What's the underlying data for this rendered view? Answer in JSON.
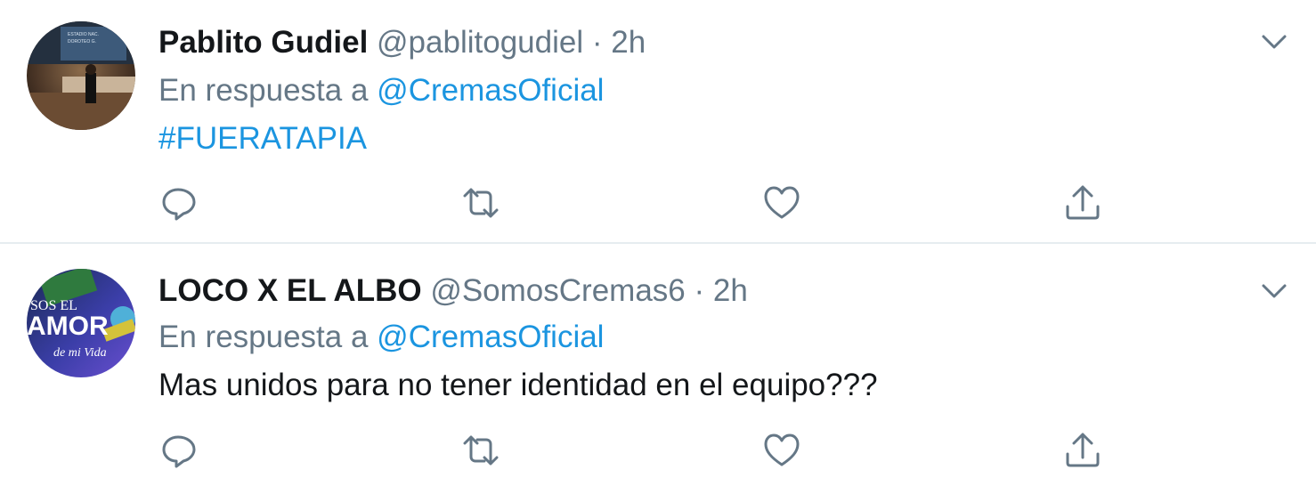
{
  "tweets": [
    {
      "display_name": "Pablito Gudiel",
      "handle": "@pablitogudiel",
      "separator": "·",
      "time": "2h",
      "reply_prefix": "En respuesta a",
      "reply_to": "@CremasOficial",
      "text": "#FUERATAPIA",
      "avatar_text": [
        "ESTADIO NAC.",
        "DOROTEO G."
      ]
    },
    {
      "display_name": "LOCO X EL ALBO",
      "handle": "@SomosCremas6",
      "separator": "·",
      "time": "2h",
      "reply_prefix": "En respuesta a",
      "reply_to": "@CremasOficial",
      "text": "Mas unidos para  no tener identidad en el equipo???",
      "avatar_text": [
        "SOS EL",
        "AMOR",
        "de mi Vida"
      ]
    }
  ],
  "icons": {
    "reply": "reply-icon",
    "retweet": "retweet-icon",
    "like": "heart-icon",
    "share": "share-icon",
    "more": "chevron-down-icon"
  },
  "colors": {
    "link": "#1b95e0",
    "muted": "#657786",
    "text": "#14171a",
    "divider": "#e6ecf0"
  }
}
